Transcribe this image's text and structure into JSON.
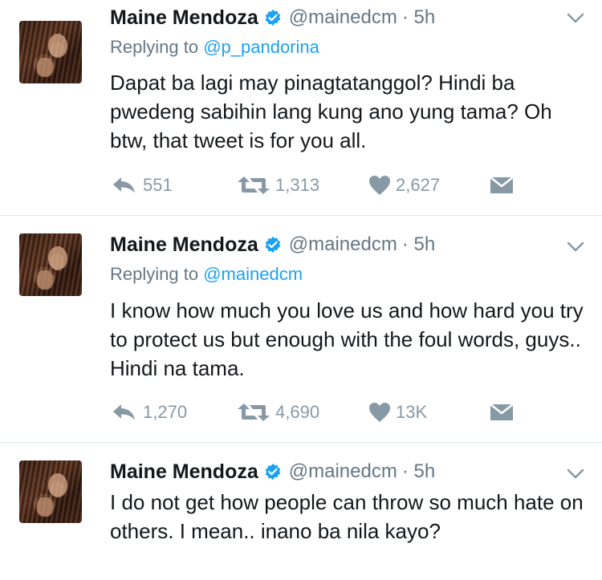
{
  "tweets": [
    {
      "name": "Maine Mendoza",
      "handle": "@mainedcm",
      "time": "· 5h",
      "replying_prefix": "Replying to",
      "replying_to": "@p_pandorina",
      "text": "Dapat ba lagi may pinagtatanggol? Hindi ba pwedeng sabihin lang kung ano yung tama? Oh btw, that tweet is for you all.",
      "replies": "551",
      "retweets": "1,313",
      "likes": "2,627"
    },
    {
      "name": "Maine Mendoza",
      "handle": "@mainedcm",
      "time": "· 5h",
      "replying_prefix": "Replying to",
      "replying_to": "@mainedcm",
      "text": "I know how much you love us and how hard you try to protect us but enough with the foul words, guys.. Hindi na tama.",
      "replies": "1,270",
      "retweets": "4,690",
      "likes": "13K"
    },
    {
      "name": "Maine Mendoza",
      "handle": "@mainedcm",
      "time": "· 5h",
      "text": "I do not get how people can throw so much hate on others. I mean.. inano ba nila kayo?"
    }
  ],
  "icons": [
    "verified-badge-icon",
    "chevron-down-icon",
    "reply-icon",
    "retweet-icon",
    "heart-icon",
    "direct-message-icon"
  ],
  "colors": {
    "link": "#1da1f2",
    "muted": "#657786",
    "action": "#8899a6",
    "divider": "#e1e8ed"
  }
}
